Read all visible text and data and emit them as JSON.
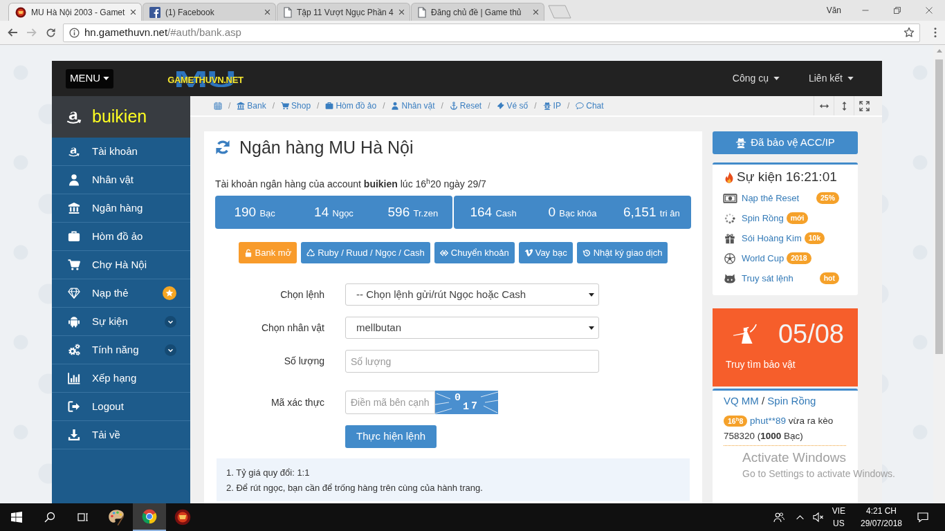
{
  "browser": {
    "tabs": [
      {
        "kind": "game",
        "title": "MU Hà Nội 2003 - Gamet",
        "selected": true
      },
      {
        "kind": "facebook",
        "title": "(1) Facebook",
        "selected": false
      },
      {
        "kind": "page",
        "title": "Tập 11 Vượt Ngục Phần 4",
        "selected": false
      },
      {
        "kind": "page",
        "title": "Đăng chủ đề | Game thủ",
        "selected": false
      }
    ],
    "profile": "Văn",
    "back_disabled": false,
    "forward_disabled": true,
    "url": {
      "host": "hn.gamethuvn.net",
      "path": "/#auth/bank.asp"
    }
  },
  "navbar": {
    "menu": "MENU",
    "logo": {
      "mark": "MU",
      "name": "GAMETHUVN.NET"
    },
    "links": [
      "Công cụ",
      "Liên kết"
    ]
  },
  "sidebar": {
    "user": "buikien",
    "items": [
      {
        "kind": "amazon",
        "label": "Tài khoản"
      },
      {
        "kind": "user",
        "label": "Nhân vật"
      },
      {
        "kind": "bank",
        "label": "Ngân hàng"
      },
      {
        "kind": "briefcase",
        "label": "Hòm đồ ảo"
      },
      {
        "kind": "cart",
        "label": "Chợ Hà Nội"
      },
      {
        "kind": "diamond",
        "label": "Nạp thẻ",
        "addon": {
          "kind": "star"
        }
      },
      {
        "kind": "android",
        "label": "Sự kiện",
        "addon": {
          "kind": "submenu"
        }
      },
      {
        "kind": "gears",
        "label": "Tính năng",
        "addon": {
          "kind": "submenu"
        }
      },
      {
        "kind": "chart",
        "label": "Xếp hạng"
      },
      {
        "kind": "logout",
        "label": "Logout"
      },
      {
        "kind": "download",
        "label": "Tải về"
      }
    ]
  },
  "breadcrumb": [
    {
      "kind": "calendar"
    },
    {
      "kind": "bank",
      "label": "Bank",
      "separator": "/"
    },
    {
      "kind": "cart",
      "label": "Shop",
      "separator": "/"
    },
    {
      "kind": "briefcase",
      "label": "Hòm đồ ảo",
      "separator": "/"
    },
    {
      "kind": "user",
      "label": "Nhân vật",
      "separator": "/"
    },
    {
      "kind": "anchor",
      "label": "Reset",
      "separator": "/"
    },
    {
      "kind": "ticket",
      "label": "Vé số",
      "separator": "/"
    },
    {
      "kind": "spy",
      "label": "IP",
      "separator": "/"
    },
    {
      "kind": "comment",
      "label": "Chat",
      "separator": "/"
    }
  ],
  "bank": {
    "title": "Ngân hàng MU Hà Nội",
    "account_line": "Tài khoản ngân hàng của account **buikien** lúc 16$^{h}$20 ngày 29/7",
    "balance_groups": [
      [
        {
          "value": "190",
          "unit": "Bạc"
        },
        {
          "value": "14",
          "unit": "Ngọc"
        },
        {
          "value": "596",
          "unit": "Tr.zen"
        }
      ],
      [
        {
          "value": "164",
          "unit": "Cash"
        },
        {
          "value": "0",
          "unit": "Bạc khóa"
        },
        {
          "value": "6,151",
          "unit": "tri ân"
        }
      ]
    ],
    "actions": [
      {
        "kind": "unlock",
        "label": "Bank mở",
        "color": "#f89b2b"
      },
      {
        "kind": "recycle",
        "label": "Ruby / Ruud / Ngọc / Cash",
        "color": "#428bca"
      },
      {
        "kind": "exchange",
        "label": "Chuyển khoản",
        "color": "#428bca"
      },
      {
        "kind": "vimeo",
        "label": "Vay bạc",
        "color": "#428bca"
      },
      {
        "kind": "history",
        "label": "Nhật ký giao dịch",
        "color": "#428bca"
      }
    ],
    "form": [
      {
        "kind": "select",
        "label": "Chọn lệnh",
        "value": "-- Chọn lệnh gửi/rút Ngọc hoặc Cash"
      },
      {
        "kind": "select",
        "label": "Chọn nhân vật",
        "value": "mellbutan"
      },
      {
        "kind": "input",
        "label": "Số lượng",
        "placeholder": "Số lượng"
      },
      {
        "kind": "captcha",
        "label": "Mã xác thực",
        "placeholder": "Điền mã bên cạnh",
        "code": "017"
      }
    ],
    "submit": "Thực hiện lệnh",
    "notes": [
      "1. Tỷ giá quy đổi: 1:1",
      "2. Để rút ngọc, bạn cần để trống hàng trên cùng của hành trang."
    ]
  },
  "right": {
    "protect": "Đã bảo vệ ACC/IP",
    "events": {
      "title": "Sự kiện 16:21:01",
      "items": [
        {
          "kind": "money",
          "label": "Nạp thẻ Reset",
          "badge": "25%",
          "badge_right": true
        },
        {
          "kind": "spinner",
          "label": "Spin Rồng",
          "badge": "mới",
          "badge_right": false
        },
        {
          "kind": "gift",
          "label": "Sói Hoàng Kim",
          "badge": "10k",
          "badge_right": false
        },
        {
          "kind": "ball",
          "label": "World Cup",
          "badge": "2018",
          "badge_right": false
        },
        {
          "kind": "cat",
          "label": "Truy sát lệnh",
          "badge": "hot",
          "badge_right": true
        }
      ]
    },
    "treasure": {
      "count": "05/08",
      "label": "Truy tìm bảo vật"
    },
    "feed": {
      "links": [
        "VQ MM",
        "Spin Rồng"
      ],
      "separator": "/",
      "entries": [
        {
          "time": "16$^{h}$8",
          "user": "phut**89",
          "text": "vừa ra kèo 758320 (**1000** Bạc)"
        }
      ]
    }
  },
  "watermark": {
    "title": "Activate Windows",
    "subtitle": "Go to Settings to activate Windows."
  },
  "taskbar": {
    "apps": [
      {
        "kind": "paint",
        "active": false
      },
      {
        "kind": "chrome",
        "active": true
      },
      {
        "kind": "game",
        "active": false
      }
    ],
    "language": "VIE",
    "region": "US",
    "time": "4:21 CH",
    "date": "29/07/2018"
  }
}
